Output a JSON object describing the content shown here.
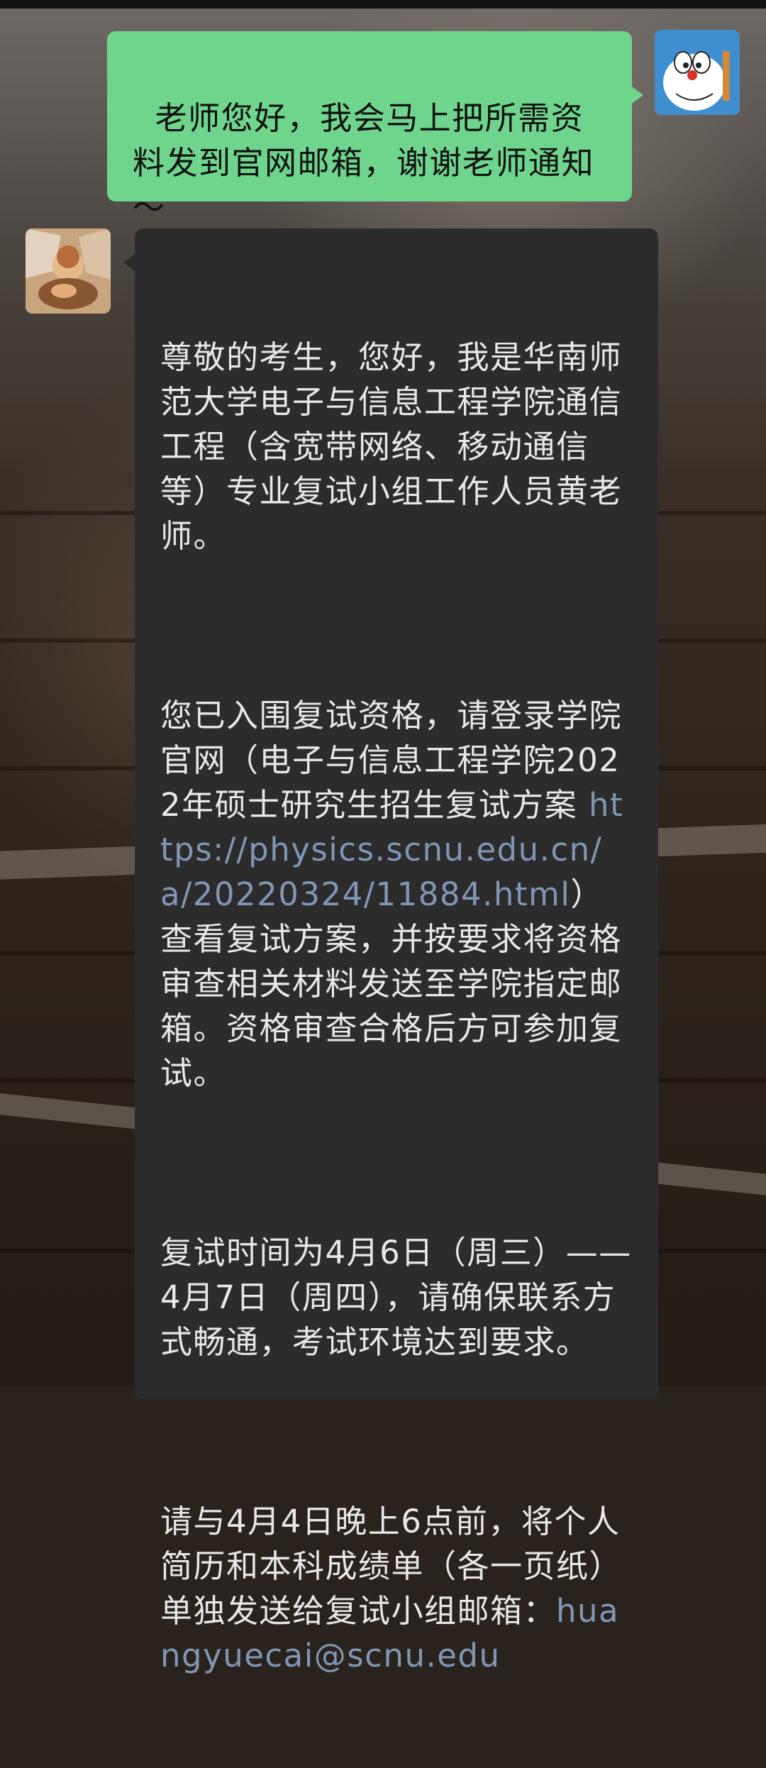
{
  "messages": {
    "sent": {
      "text": "老师您好，我会马上把所需资料发到官网邮箱，谢谢老师通知～"
    },
    "received": {
      "p1": "尊敬的考生，您好，我是华南师范大学电子与信息工程学院通信工程（含宽带网络、移动通信等）专业复试小组工作人员黄老师。",
      "p2_prefix": "您已入围复试资格，请登录学院官网（电子与信息工程学院2022年硕士研究生招生复试方案 ",
      "p2_link": "https://physics.scnu.edu.cn/a/20220324/11884.html",
      "p2_suffix": "）查看复试方案，并按要求将资格审查相关材料发送至学院指定邮箱。资格审查合格后方可参加复试。",
      "p3": "复试时间为4月6日（周三）——4月7日（周四），请确保联系方式畅通，考试环境达到要求。",
      "p4_prefix": "请与4月4日晚上6点前，将个人简历和本科成绩单（各一页纸）单独发送给复试小组邮箱：",
      "p4_link": "huangyuecai@scnu.edu"
    }
  },
  "avatars": {
    "self": "doraemon-avatar",
    "other": "cherub-avatar"
  },
  "colors": {
    "sent_bubble": "#6fd58d",
    "received_bubble": "#2c2c2c",
    "link": "#7f97b6"
  }
}
